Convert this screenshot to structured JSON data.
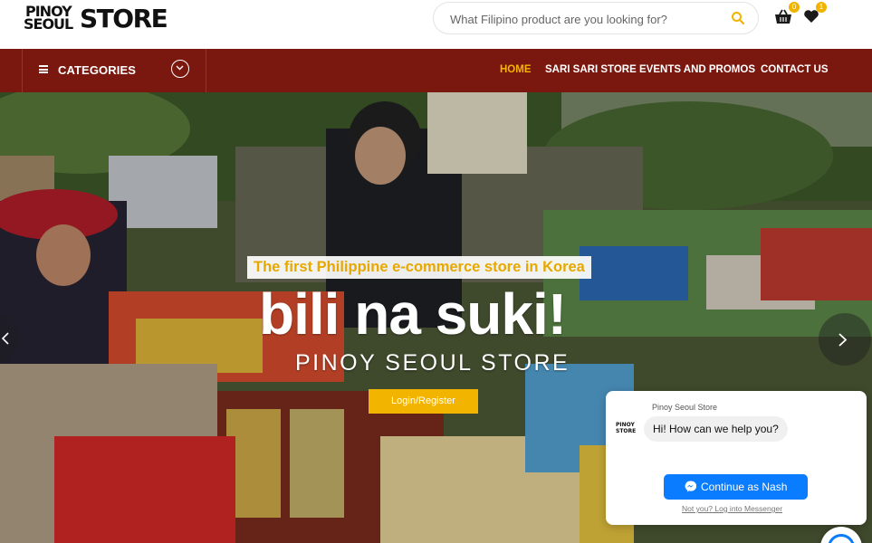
{
  "brand": {
    "line1": "PINOY",
    "line2": "SEOUL",
    "line3": "STORE"
  },
  "search": {
    "placeholder": "What Filipino product are you looking for?",
    "icon": "search-icon"
  },
  "header_icons": {
    "cart_count": "0",
    "wishlist_count": "1"
  },
  "nav": {
    "categories_label": "CATEGORIES",
    "items": [
      "HOME",
      "SARI SARI STORE",
      "EVENTS AND PROMOS",
      "CONTACT US"
    ],
    "active_index": 0,
    "accent_color": "#f5b400",
    "bar_color": "#7a1810"
  },
  "hero": {
    "tagline": "The first Philippine e-commerce store in Korea",
    "headline": "bili na suki!",
    "subheadline": "PINOY SEOUL STORE",
    "cta_label": "Login/Register"
  },
  "messenger": {
    "page_name": "Pinoy Seoul Store",
    "avatar_text": "PINOY STORE",
    "greeting": "Hi! How can we help you?",
    "continue_label": "Continue as Nash",
    "not_you_label": "Not you? Log into Messenger",
    "button_color": "#0a7cff"
  }
}
